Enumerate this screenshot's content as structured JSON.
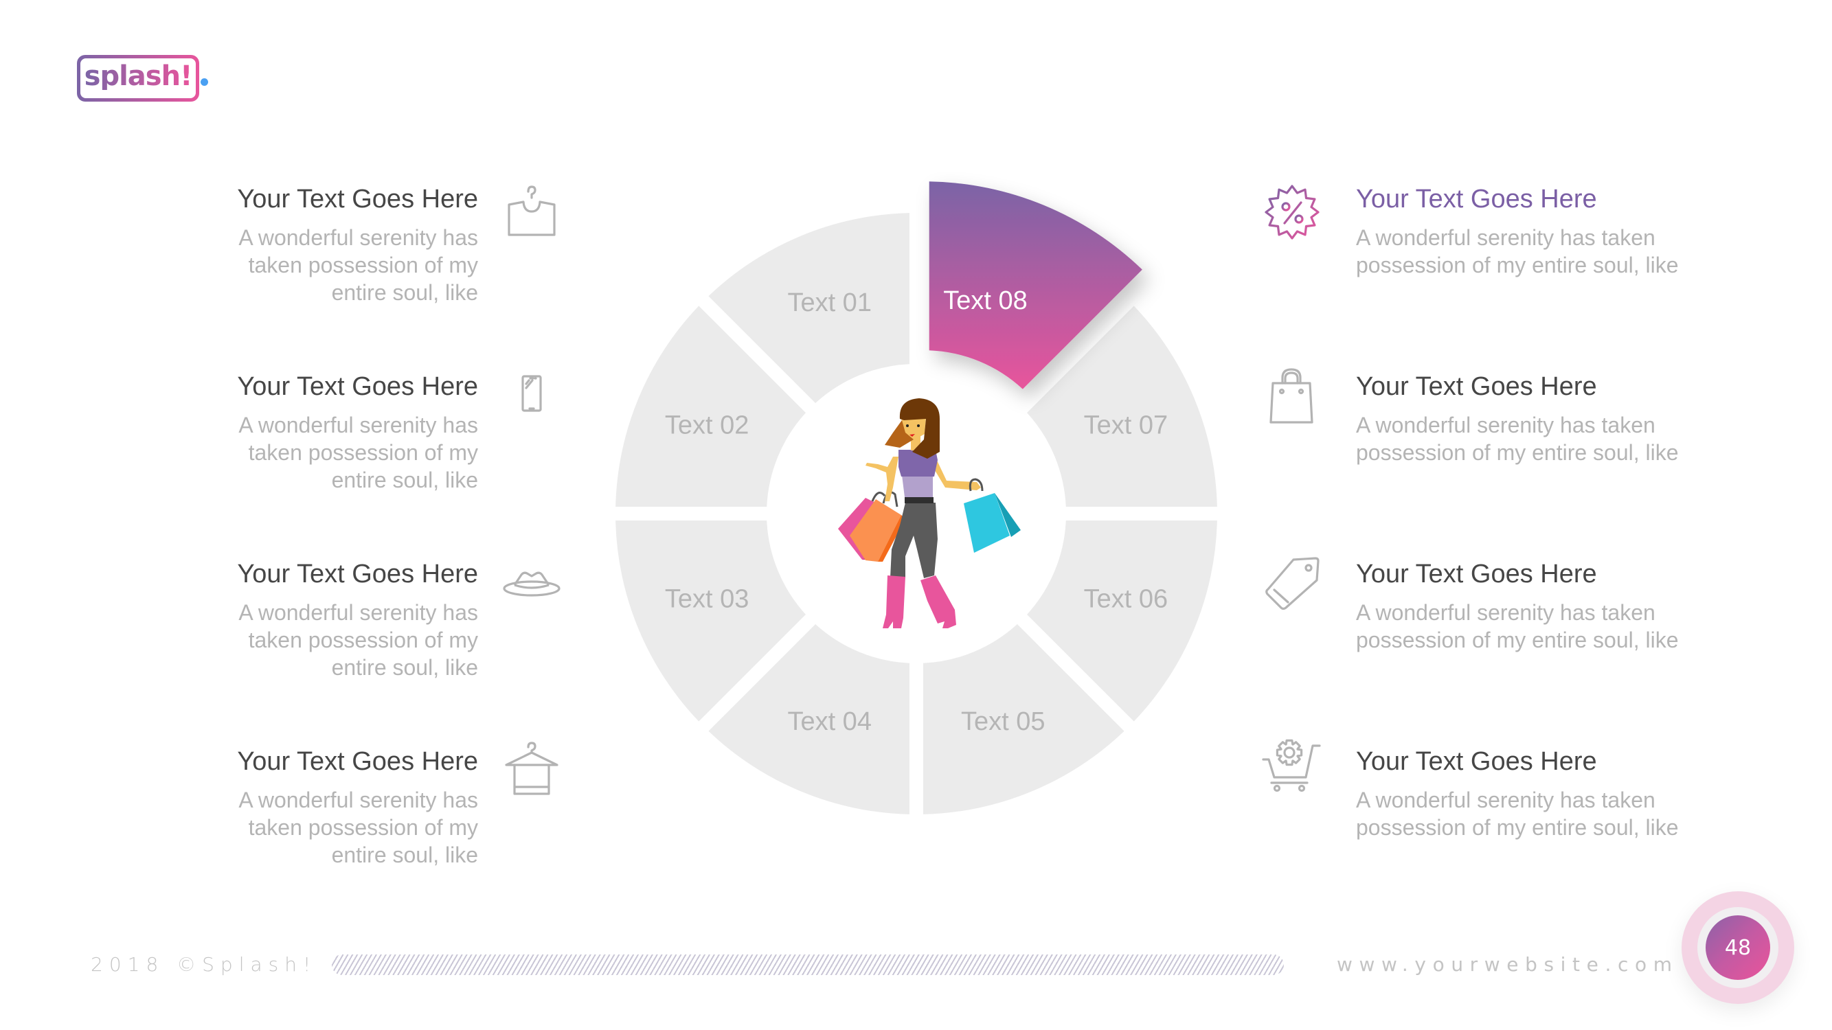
{
  "brand": {
    "logo_text": "splash!",
    "gradient_start": "#7b64a6",
    "gradient_end": "#e8559c",
    "dot_color": "#4aa0f2"
  },
  "left_features": [
    {
      "title": "Your Text Goes Here",
      "body": "A wonderful serenity has taken possession of my entire soul, like",
      "icon": "hanger-shirt-icon"
    },
    {
      "title": "Your Text Goes Here",
      "body": "A wonderful serenity has taken possession of my entire soul, like",
      "icon": "smartphone-icon"
    },
    {
      "title": "Your Text Goes Here",
      "body": "A wonderful serenity has taken possession of my entire soul, like",
      "icon": "hat-icon"
    },
    {
      "title": "Your Text Goes Here",
      "body": "A wonderful serenity has taken possession of my entire soul, like",
      "icon": "hanger-towel-icon"
    }
  ],
  "right_features": [
    {
      "title": "Your Text Goes Here",
      "body": "A wonderful serenity has taken possession of my entire soul, like",
      "icon": "discount-badge-icon",
      "highlighted": true
    },
    {
      "title": "Your Text Goes Here",
      "body": "A wonderful serenity has taken possession of my entire soul, like",
      "icon": "shopping-bag-icon"
    },
    {
      "title": "Your Text Goes Here",
      "body": "A wonderful serenity has taken possession of my entire soul, like",
      "icon": "price-tag-icon"
    },
    {
      "title": "Your Text Goes Here",
      "body": "A wonderful serenity has taken possession of my entire soul, like",
      "icon": "cart-settings-icon"
    }
  ],
  "ring": {
    "segments": [
      {
        "label": "Text 01"
      },
      {
        "label": "Text 02"
      },
      {
        "label": "Text 03"
      },
      {
        "label": "Text 04"
      },
      {
        "label": "Text 05"
      },
      {
        "label": "Text 06"
      },
      {
        "label": "Text 07"
      },
      {
        "label": "Text 08",
        "active": true
      }
    ],
    "segment_color": "#ebebeb",
    "active_gradient_top": "#7b64a6",
    "active_gradient_bottom": "#e8559c",
    "center_illustration": "woman-with-shopping-bags"
  },
  "footer": {
    "copyright": "2018 ©Splash!",
    "website": "www.yourwebsite.com",
    "page_number": "48"
  }
}
